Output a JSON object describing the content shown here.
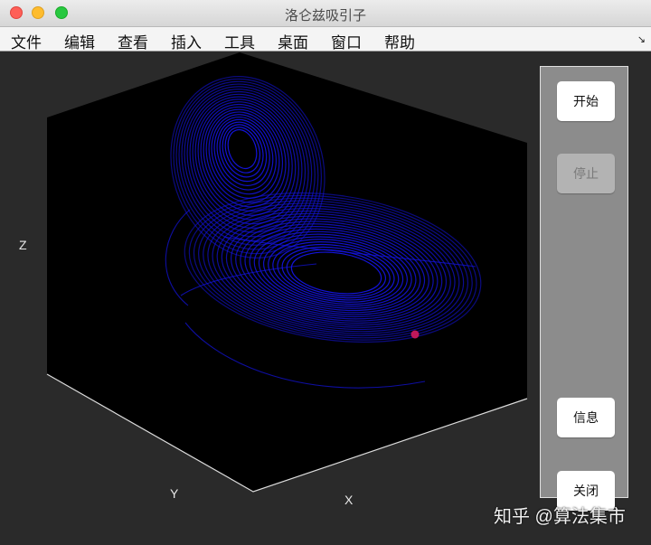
{
  "window": {
    "title": "洛仑兹吸引子"
  },
  "menu": {
    "items": [
      "文件",
      "编辑",
      "查看",
      "插入",
      "工具",
      "桌面",
      "窗口",
      "帮助"
    ],
    "overflow_icon": "chevron-corner-icon"
  },
  "plot": {
    "axis_labels": {
      "x": "X",
      "y": "Y",
      "z": "Z"
    },
    "trajectory_color": "#1414e6",
    "marker_color": "#c0185a",
    "background_color": "#000000"
  },
  "controls": {
    "start": "开始",
    "stop": "停止",
    "info": "信息",
    "close": "关闭"
  },
  "watermark": "知乎 @算法集市"
}
